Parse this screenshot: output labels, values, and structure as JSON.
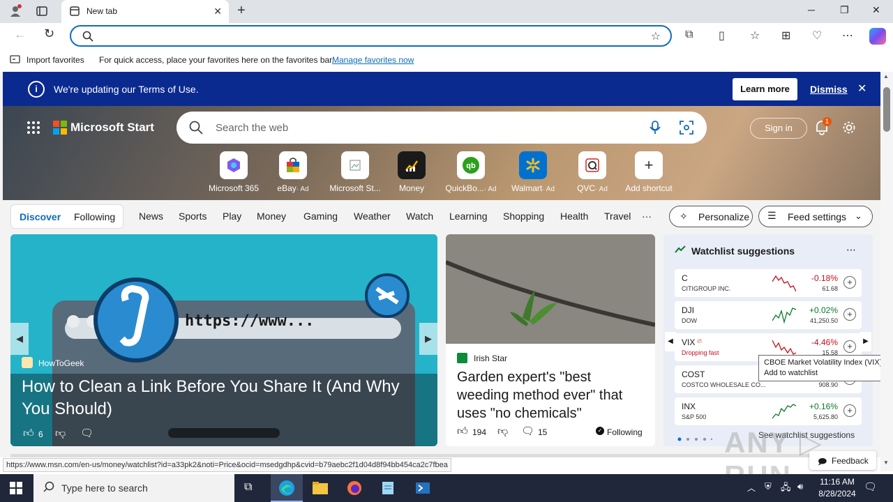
{
  "browser": {
    "tab_title": "New tab",
    "favorites_bar": {
      "import_label": "Import favorites",
      "hint_text": "For quick access, place your favorites here on the favorites bar.",
      "manage_link": "Manage favorites now"
    },
    "status_url": "https://www.msn.com/en-us/money/watchlist?id=a33pk2&noti=Price&ocid=msedgdhp&cvid=b79aebc2f1d04d8f94bb454ca2c7fbea"
  },
  "terms_banner": {
    "text": "We're updating our Terms of Use.",
    "learn_more": "Learn more",
    "dismiss": "Dismiss"
  },
  "header": {
    "brand": "Microsoft Start",
    "search_placeholder": "Search the web",
    "sign_in": "Sign in",
    "notification_count": "1"
  },
  "shortcuts": [
    {
      "label": "Microsoft 365",
      "ad": ""
    },
    {
      "label": "eBay",
      "ad": "· Ad"
    },
    {
      "label": "Microsoft St...",
      "ad": ""
    },
    {
      "label": "Money",
      "ad": ""
    },
    {
      "label": "QuickBo...",
      "ad": "· Ad"
    },
    {
      "label": "Walmart",
      "ad": "· Ad"
    },
    {
      "label": "QVC",
      "ad": "· Ad"
    },
    {
      "label": "Add shortcut",
      "ad": ""
    }
  ],
  "feed_tabs": {
    "discover": "Discover",
    "following": "Following",
    "links": [
      "News",
      "Sports",
      "Play",
      "Money",
      "Gaming",
      "Weather",
      "Watch",
      "Learning",
      "Shopping",
      "Health",
      "Travel"
    ],
    "more": "···",
    "personalize": "Personalize",
    "feed_settings": "Feed settings"
  },
  "hero_card": {
    "url_text": "https://www...",
    "source": "HowToGeek",
    "headline": "How to Clean a Link Before You Share It (And Why You Should)",
    "likes": "6"
  },
  "news_card": {
    "source": "Irish Star",
    "headline": "Garden expert's \"best weeding method ever\" that uses \"no chemicals\"",
    "likes": "194",
    "comments": "15",
    "following": "Following"
  },
  "watchlist": {
    "title": "Watchlist suggestions",
    "rows": [
      {
        "symbol": "C",
        "name": "CITIGROUP INC.",
        "change": "-0.18%",
        "price": "61.68",
        "trend": "neg"
      },
      {
        "symbol": "DJI",
        "name": "DOW",
        "change": "+0.02%",
        "price": "41,250.50",
        "trend": "pos"
      },
      {
        "symbol": "VIX",
        "name": "Dropping fast",
        "change": "-4.46%",
        "price": "15.58",
        "trend": "neg"
      },
      {
        "symbol": "COST",
        "name": "COSTCO WHOLESALE CO...",
        "change": "",
        "price": "908.90",
        "trend": "pos"
      },
      {
        "symbol": "INX",
        "name": "S&P 500",
        "change": "+0.16%",
        "price": "5,625.80",
        "trend": "pos"
      }
    ],
    "tooltip_line1": "CBOE Market Volatility Index (VIX)",
    "tooltip_line2": "Add to watchlist",
    "see_more": "See watchlist suggestions"
  },
  "feedback": "Feedback",
  "taskbar": {
    "search_placeholder": "Type here to search",
    "time": "11:16 AM",
    "date": "8/28/2024"
  },
  "colors": {
    "edge_blue": "#0f6cbd",
    "terms_banner": "#0a2a8f",
    "negative": "#c50f1f",
    "positive": "#0b7a2b"
  }
}
